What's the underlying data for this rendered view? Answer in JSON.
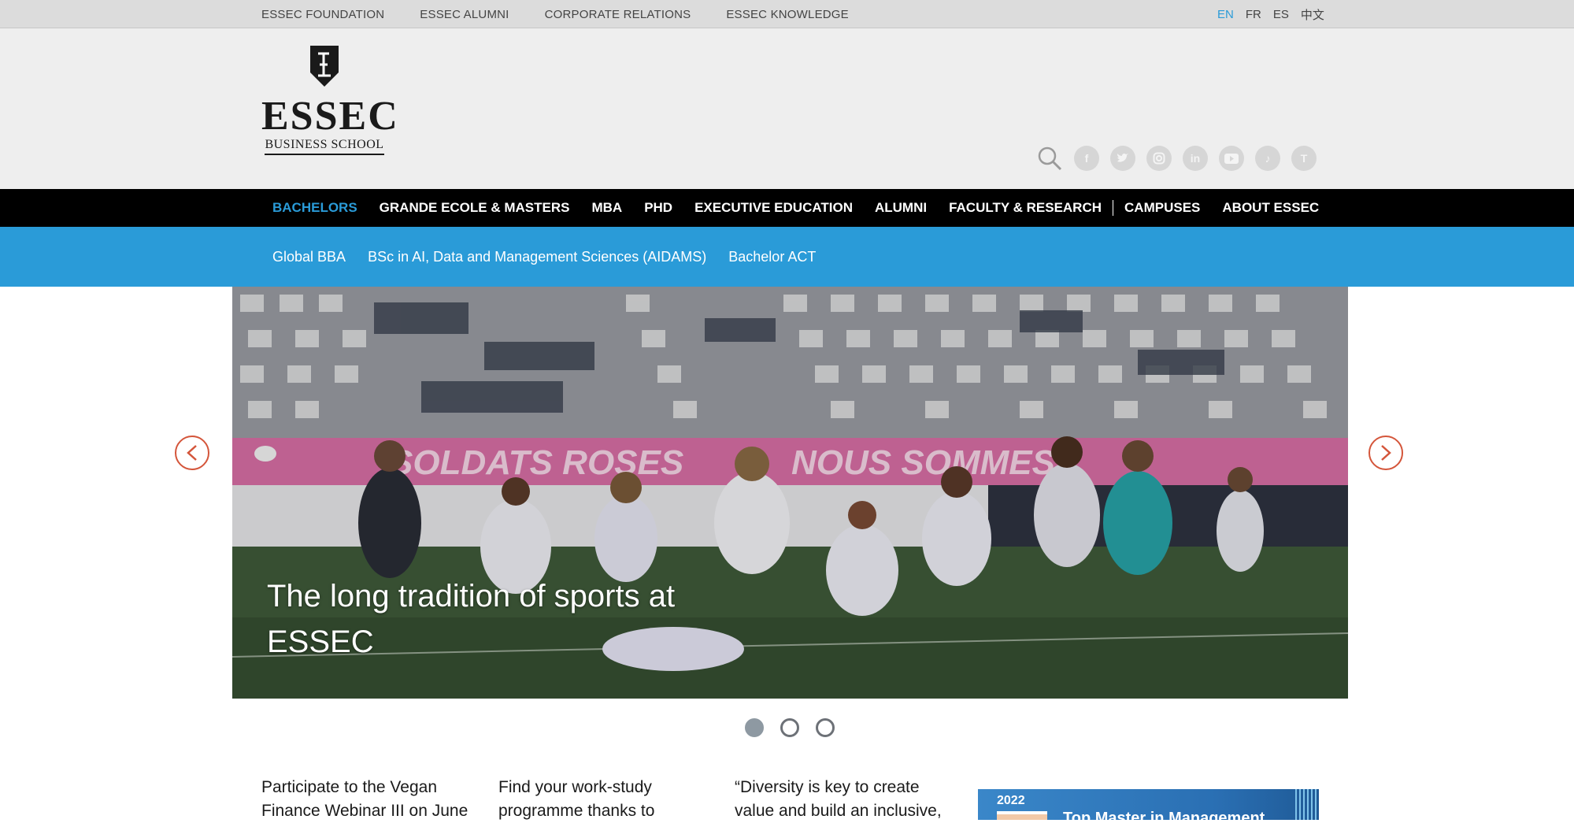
{
  "topbar": {
    "links": [
      "ESSEC FOUNDATION",
      "ESSEC ALUMNI",
      "CORPORATE RELATIONS",
      "ESSEC KNOWLEDGE"
    ],
    "languages": [
      {
        "label": "EN",
        "active": true
      },
      {
        "label": "FR",
        "active": false
      },
      {
        "label": "ES",
        "active": false
      },
      {
        "label": "中文",
        "active": false
      }
    ]
  },
  "header": {
    "logo_wordmark": "ESSEC",
    "logo_subtitle": "BUSINESS SCHOOL",
    "social_icons": [
      "facebook-icon",
      "twitter-icon",
      "instagram-icon",
      "linkedin-icon",
      "youtube-icon",
      "tiktok-icon",
      "tumblr-icon"
    ]
  },
  "main_nav": {
    "items": [
      {
        "label": "BACHELORS",
        "active": true
      },
      {
        "label": "GRANDE ECOLE & MASTERS",
        "active": false
      },
      {
        "label": "MBA",
        "active": false
      },
      {
        "label": "PHD",
        "active": false
      },
      {
        "label": "EXECUTIVE EDUCATION",
        "active": false
      },
      {
        "label": "ALUMNI",
        "active": false
      },
      {
        "label": "FACULTY & RESEARCH",
        "active": false
      },
      {
        "label": "CAMPUSES",
        "active": false
      },
      {
        "label": "ABOUT ESSEC",
        "active": false
      }
    ]
  },
  "sub_nav": {
    "items": [
      "Global BBA",
      "BSc in AI, Data and Management Sciences (AIDAMS)",
      "Bachelor ACT"
    ]
  },
  "hero": {
    "caption": "The long tradition of sports at ESSEC",
    "banner_left": "SOLDATS ROSES",
    "banner_right": "NOUS SOMMES",
    "slide_count": 3,
    "active_slide": 0
  },
  "news": [
    {
      "text": "Participate to the Vegan Finance Webinar III on June"
    },
    {
      "text": "Find your work-study programme thanks to"
    },
    {
      "text": "“Diversity is key to create value and build an inclusive,"
    }
  ],
  "promo": {
    "year": "2022",
    "title": "Top Master in Management"
  },
  "colors": {
    "accent_blue": "#2a9bd8",
    "arrow_orange": "#d4553a",
    "nav_black": "#000000"
  }
}
